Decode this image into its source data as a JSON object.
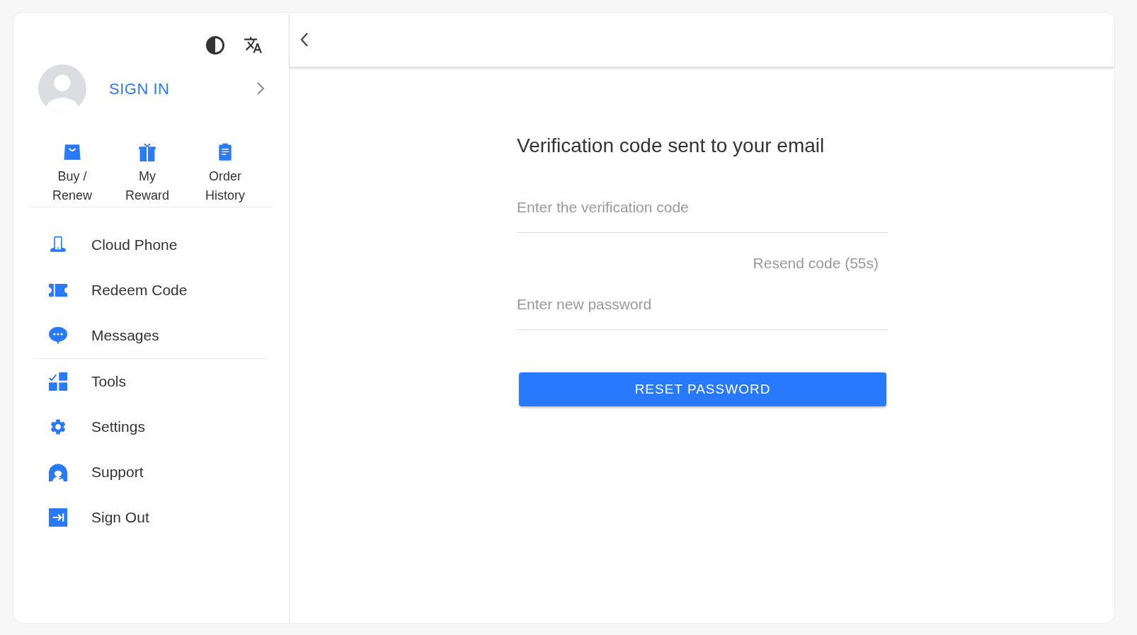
{
  "sidebar": {
    "account": {
      "sign_in": "SIGN IN"
    },
    "quick_actions": [
      {
        "label": "Buy / Renew"
      },
      {
        "label": "My Reward"
      },
      {
        "label": "Order History"
      }
    ],
    "menu_groups": [
      {
        "items": [
          {
            "label": "Cloud Phone"
          },
          {
            "label": "Redeem Code"
          },
          {
            "label": "Messages"
          }
        ]
      },
      {
        "items": [
          {
            "label": "Tools"
          },
          {
            "label": "Settings"
          },
          {
            "label": "Support"
          },
          {
            "label": "Sign Out"
          }
        ]
      }
    ]
  },
  "reset_form": {
    "title": "Verification code sent to your email",
    "code_field": {
      "placeholder": "Enter the verification code"
    },
    "resend_link": {
      "label": "Resend code (55s)",
      "disabled": true
    },
    "password_field": {
      "placeholder": "Enter new password"
    },
    "submit_button": "RESET PASSWORD"
  }
}
